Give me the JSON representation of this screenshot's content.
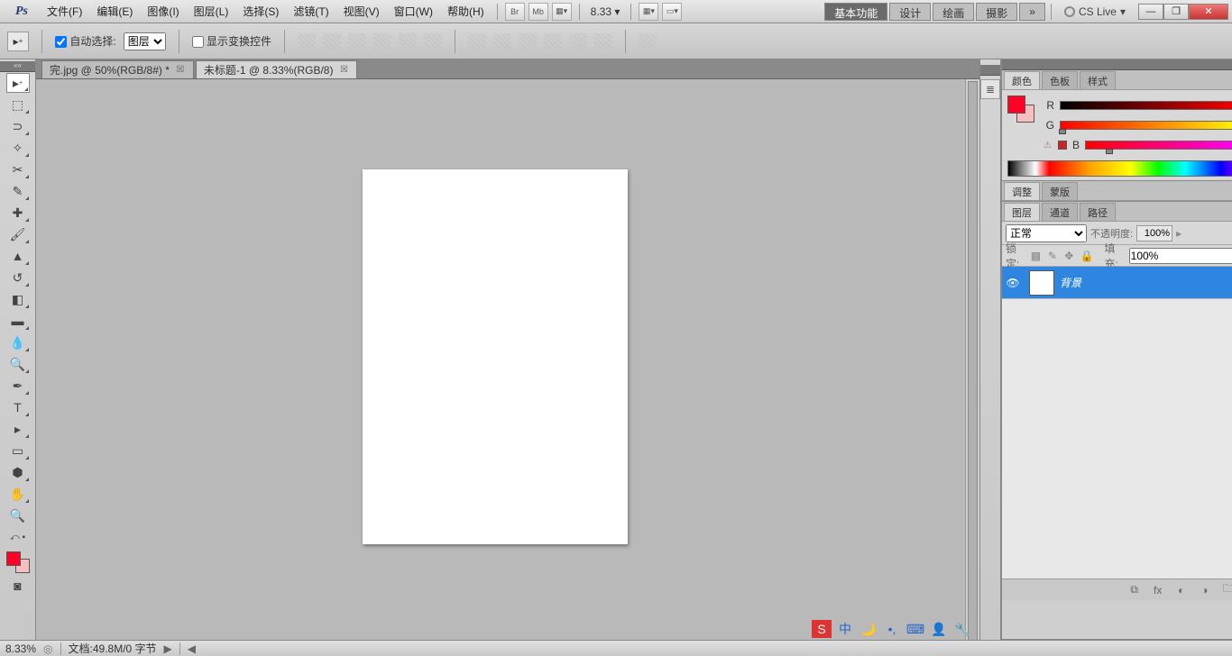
{
  "menu": {
    "items": [
      "文件(F)",
      "编辑(E)",
      "图像(I)",
      "图层(L)",
      "选择(S)",
      "滤镜(T)",
      "视图(V)",
      "窗口(W)",
      "帮助(H)"
    ],
    "br": "Br",
    "mb": "Mb",
    "zoom": "8.33",
    "workspaces": [
      "基本功能",
      "设计",
      "绘画",
      "摄影"
    ],
    "cslive": "CS Live"
  },
  "options": {
    "auto_select_label": "自动选择:",
    "auto_select_value": "图层",
    "show_transform_label": "显示变换控件"
  },
  "doctabs": [
    {
      "label": "完.jpg @ 50%(RGB/8#) *",
      "active": false
    },
    {
      "label": "未标题-1 @ 8.33%(RGB/8)",
      "active": true
    }
  ],
  "color_panel": {
    "tabs": [
      "颜色",
      "色板",
      "样式"
    ],
    "rgb": {
      "R": "255",
      "G": "2",
      "B": "38"
    },
    "fg": "#ff0226",
    "bg": "#f7c0c0"
  },
  "mid_panel": {
    "tabs": [
      "调整",
      "蒙版"
    ]
  },
  "layers_panel": {
    "tabs": [
      "图层",
      "通道",
      "路径"
    ],
    "blend_mode": "正常",
    "opacity_label": "不透明度:",
    "opacity": "100%",
    "lock_label": "锁定:",
    "fill_label": "填充:",
    "fill": "100%",
    "layers": [
      {
        "name": "背景",
        "locked": true
      }
    ]
  },
  "status": {
    "zoom": "8.33%",
    "docinfo": "文档:49.8M/0 字节"
  },
  "tools": [
    "↕",
    "⬚",
    "⊞",
    "✎",
    "✂",
    "◐",
    "⌖",
    "✐",
    "◧",
    "▲",
    "⊟",
    "≡",
    "◐",
    "◉",
    "◊",
    "●",
    "◔",
    "✎",
    "T",
    "▸",
    "◻",
    "✋",
    "🔍"
  ]
}
